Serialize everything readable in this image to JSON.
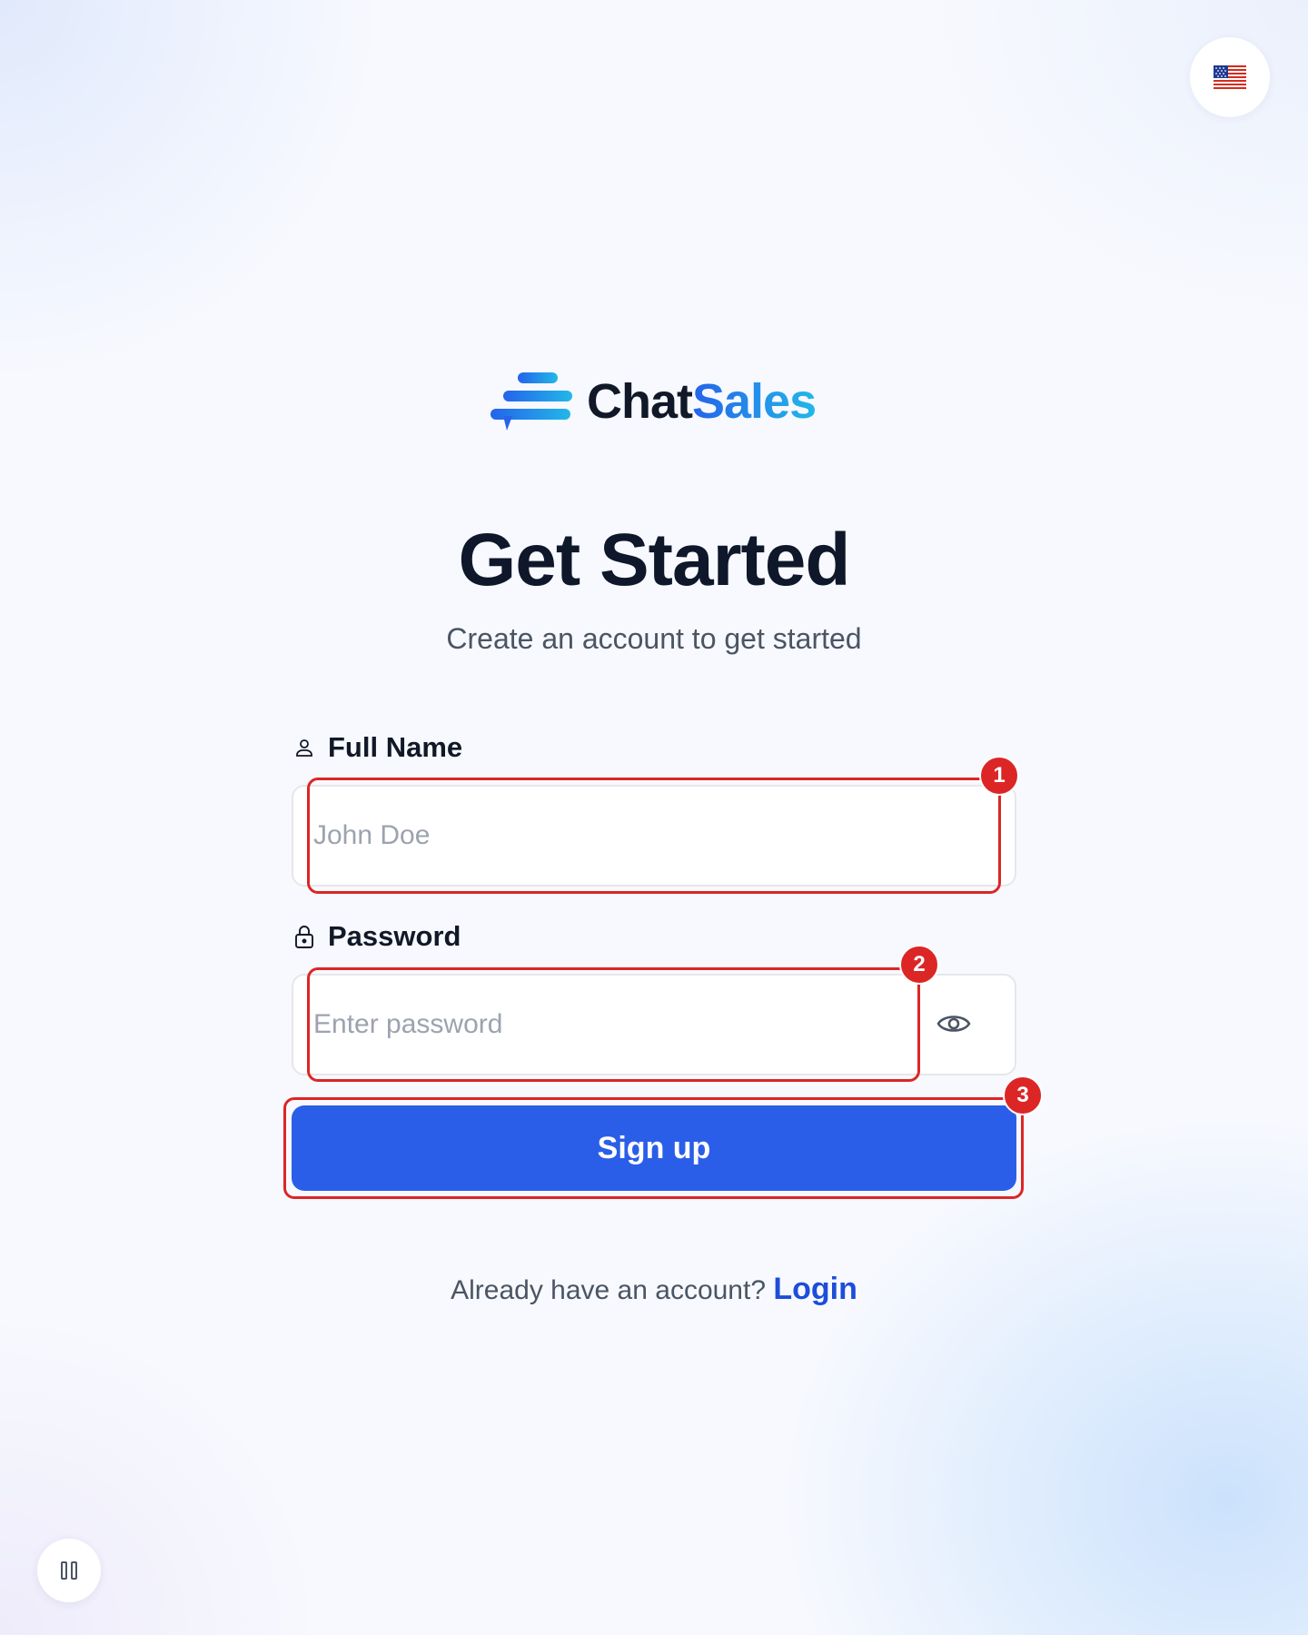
{
  "brand": {
    "name_part1": "Chat",
    "name_part2": "Sales",
    "logo_icon": "chat-stack-logo-icon",
    "accent_color": "#2563eb",
    "gradient_end_color": "#22b8e8"
  },
  "header": {
    "language_icon": "us-flag-icon"
  },
  "main": {
    "title": "Get Started",
    "subtitle": "Create an account to get started"
  },
  "form": {
    "full_name": {
      "label": "Full Name",
      "icon": "user-icon",
      "placeholder": "John Doe",
      "value": ""
    },
    "password": {
      "label": "Password",
      "icon": "lock-icon",
      "placeholder": "Enter password",
      "value": "",
      "toggle_icon": "eye-icon"
    },
    "submit_label": "Sign up",
    "submit_color": "#2b5ee8"
  },
  "footer": {
    "prompt": "Already have an account?",
    "login_label": "Login"
  },
  "controls": {
    "pause_icon": "pause-icon"
  },
  "annotations": {
    "color": "#dc2626",
    "items": [
      {
        "label": "1"
      },
      {
        "label": "2"
      },
      {
        "label": "3"
      }
    ]
  }
}
